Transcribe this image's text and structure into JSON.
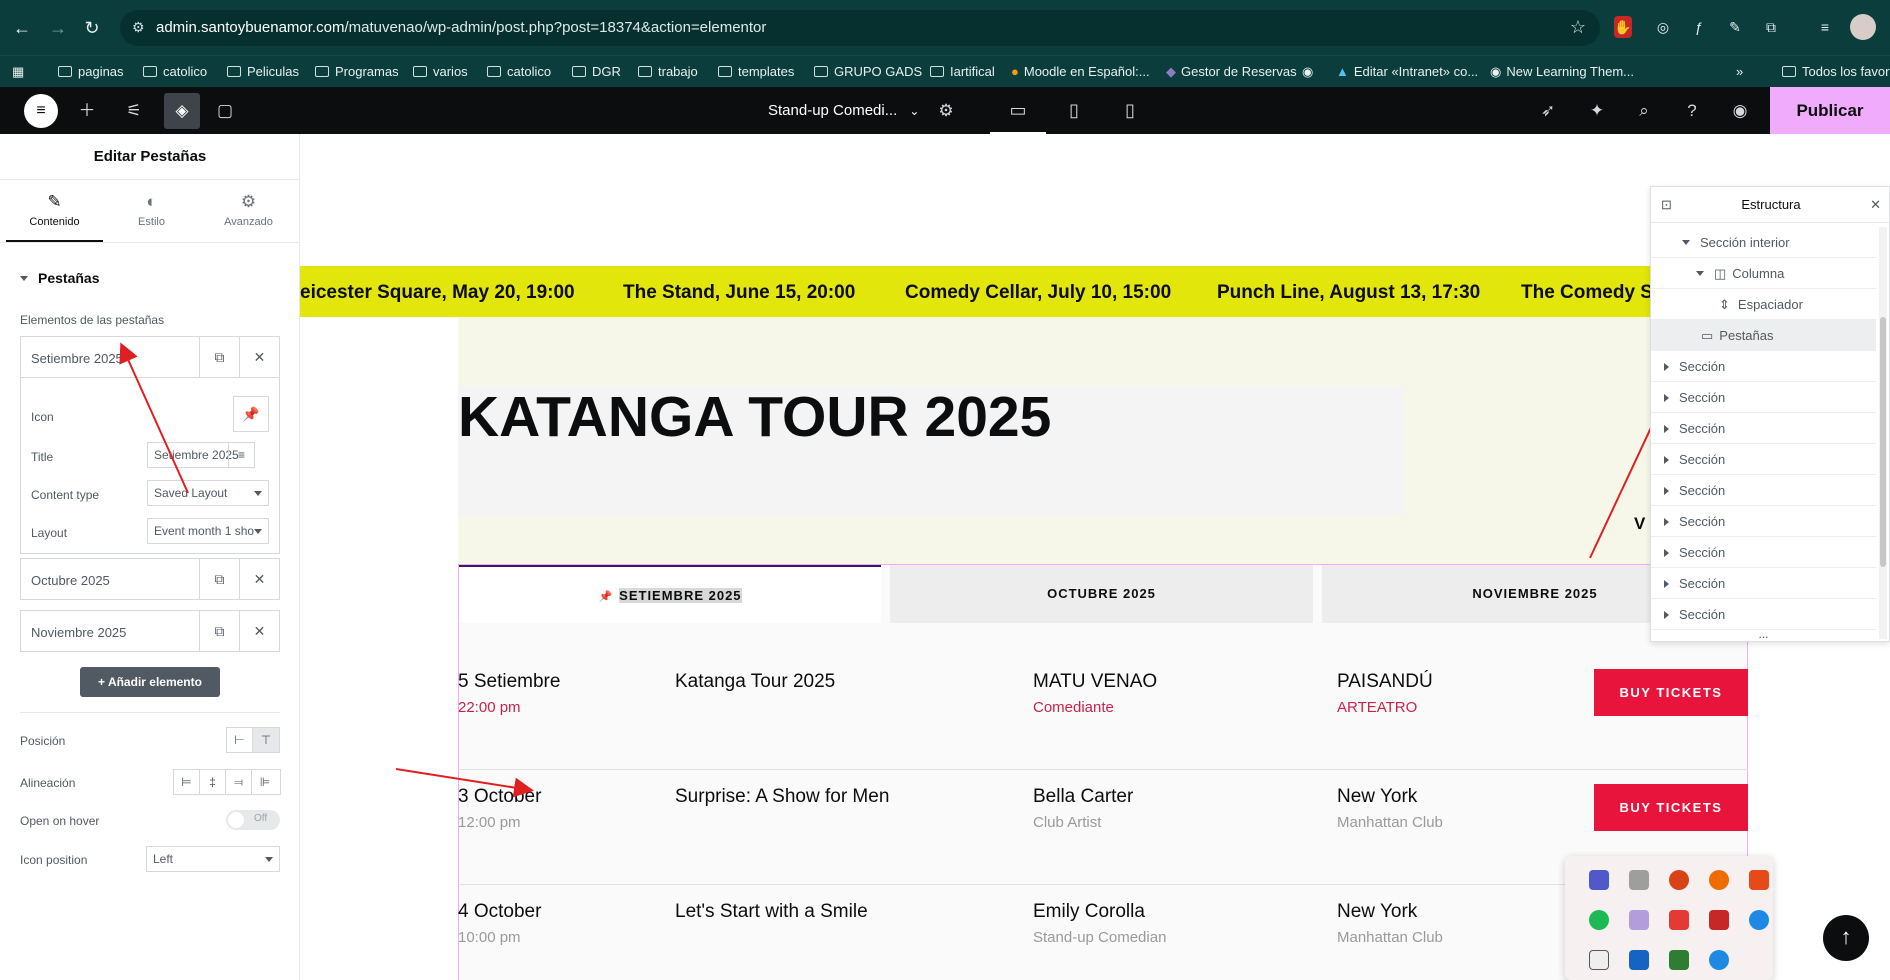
{
  "browser": {
    "url_host": "admin.santoybuenamor.com",
    "url_path": "/matuvenao/wp-admin/post.php?post=18374&action=elementor",
    "bookmarks": [
      "paginas",
      "catolico",
      "Peliculas",
      "Programas",
      "varios",
      "catolico",
      "DGR",
      "trabajo",
      "templates",
      "GRUPO GADS",
      "Iartifical",
      "Moodle en Español:...",
      "Gestor de Reservas",
      "Editar «Intranet» co...",
      "New Learning Them...",
      "Todos los favoritos"
    ],
    "more": "»"
  },
  "editor": {
    "doc_title": "Stand-up Comedi...",
    "publish": "Publicar"
  },
  "panel": {
    "title": "Editar Pestañas",
    "tabs": [
      "Contenido",
      "Estilo",
      "Avanzado"
    ],
    "section": "Pestañas",
    "items_label": "Elementos de las pestañas",
    "items": [
      "Setiembre 2025",
      "Octubre 2025",
      "Noviembre 2025"
    ],
    "fields": {
      "icon_label": "Icon",
      "title_label": "Title",
      "title_value": "Setiembre 2025",
      "content_type_label": "Content type",
      "content_type_value": "Saved Layout",
      "layout_label": "Layout",
      "layout_value": "Event month 1 sho"
    },
    "add_button": "Añadir elemento",
    "position_label": "Posición",
    "alignment_label": "Alineación",
    "open_hover_label": "Open on hover",
    "open_hover_value": "Off",
    "icon_position_label": "Icon position",
    "icon_position_value": "Left"
  },
  "canvas": {
    "ticker": [
      "eicester Square, May 20, 19:00",
      "The Stand, June 15, 20:00",
      "Comedy Cellar, July 10, 15:00",
      "Punch Line, August 13, 17:30",
      "The Comedy S"
    ],
    "heading": "KATANGA TOUR 2025",
    "side_letter": "V",
    "tabs": [
      "SETIEMBRE 2025",
      "OCTUBRE 2025",
      "NOVIEMBRE 2025"
    ],
    "events": [
      {
        "date": "5 Setiembre",
        "time": "22:00 pm",
        "name": "Katanga Tour 2025",
        "artist": "MATU VENAO",
        "role": "Comediante",
        "city": "PAISANDÚ",
        "venue": "ARTEATRO",
        "button": "BUY TICKETS"
      },
      {
        "date": "3 October",
        "time": "12:00 pm",
        "name": "Surprise: A Show for Men",
        "artist": "Bella Carter",
        "role": "Club Artist",
        "city": "New York",
        "venue": "Manhattan Club",
        "button": "BUY TICKETS"
      },
      {
        "date": "4 October",
        "time": "10:00 pm",
        "name": "Let's Start with a Smile",
        "artist": "Emily Corolla",
        "role": "Stand-up Comedian",
        "city": "New York",
        "venue": "Manhattan Club"
      }
    ]
  },
  "structure": {
    "title": "Estructura",
    "items": [
      "Sección interior",
      "Columna",
      "Espaciador",
      "Pestañas",
      "Sección",
      "Sección",
      "Sección",
      "Sección",
      "Sección",
      "Sección",
      "Sección",
      "Sección",
      "Sección"
    ],
    "more": "..."
  },
  "colors": {
    "accent": "#f0abfc",
    "buy": "#e8143c",
    "ticker": "#e2e60b",
    "chrome": "#0b3d3d"
  }
}
